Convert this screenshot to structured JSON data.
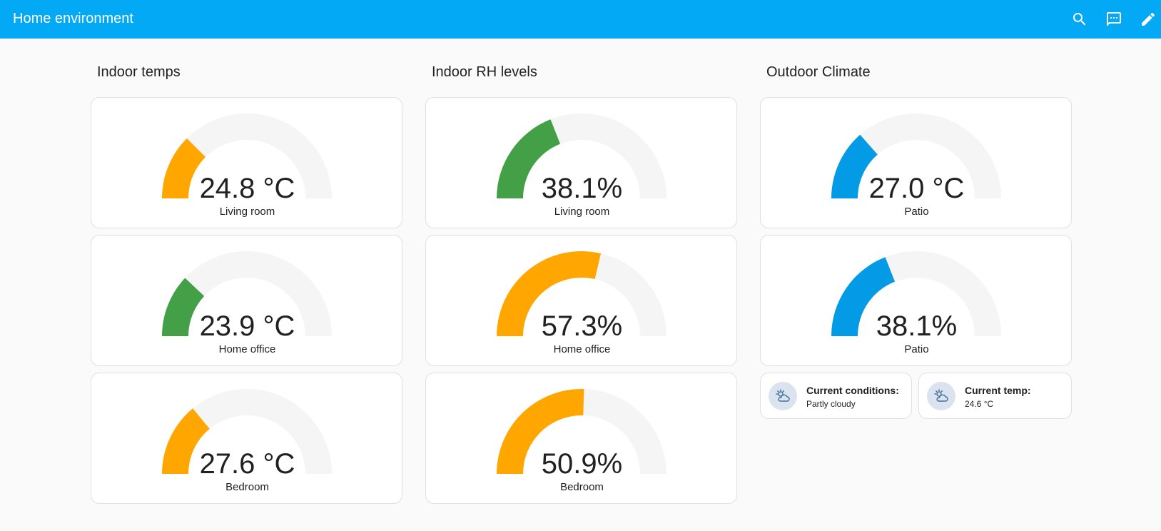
{
  "app": {
    "title": "Home environment",
    "icons": [
      "search-icon",
      "assist-icon",
      "edit-icon"
    ]
  },
  "colors": {
    "header": "#03a9f4",
    "orange": "#ffa600",
    "green": "#43a047",
    "blue": "#039be5",
    "track": "#f5f5f5"
  },
  "columns": [
    {
      "title": "Indoor temps",
      "gauges": [
        {
          "value": "24.8 °C",
          "name": "Living room",
          "level": 0.25,
          "color": "orange"
        },
        {
          "value": "23.9 °C",
          "name": "Home office",
          "level": 0.24,
          "color": "green"
        },
        {
          "value": "27.6 °C",
          "name": "Bedroom",
          "level": 0.28,
          "color": "orange"
        }
      ]
    },
    {
      "title": "Indoor RH levels",
      "gauges": [
        {
          "value": "38.1%",
          "name": "Living room",
          "level": 0.381,
          "color": "green"
        },
        {
          "value": "57.3%",
          "name": "Home office",
          "level": 0.573,
          "color": "orange"
        },
        {
          "value": "50.9%",
          "name": "Bedroom",
          "level": 0.509,
          "color": "orange"
        }
      ]
    },
    {
      "title": "Outdoor Climate",
      "gauges": [
        {
          "value": "27.0 °C",
          "name": "Patio",
          "level": 0.27,
          "color": "blue"
        },
        {
          "value": "38.1%",
          "name": "Patio",
          "level": 0.381,
          "color": "blue"
        }
      ],
      "tiles": [
        {
          "label": "Current conditions:",
          "value": "Partly cloudy",
          "icon": "partly-cloudy-icon"
        },
        {
          "label": "Current temp:",
          "value": "24.6 °C",
          "icon": "partly-cloudy-icon"
        }
      ]
    }
  ]
}
